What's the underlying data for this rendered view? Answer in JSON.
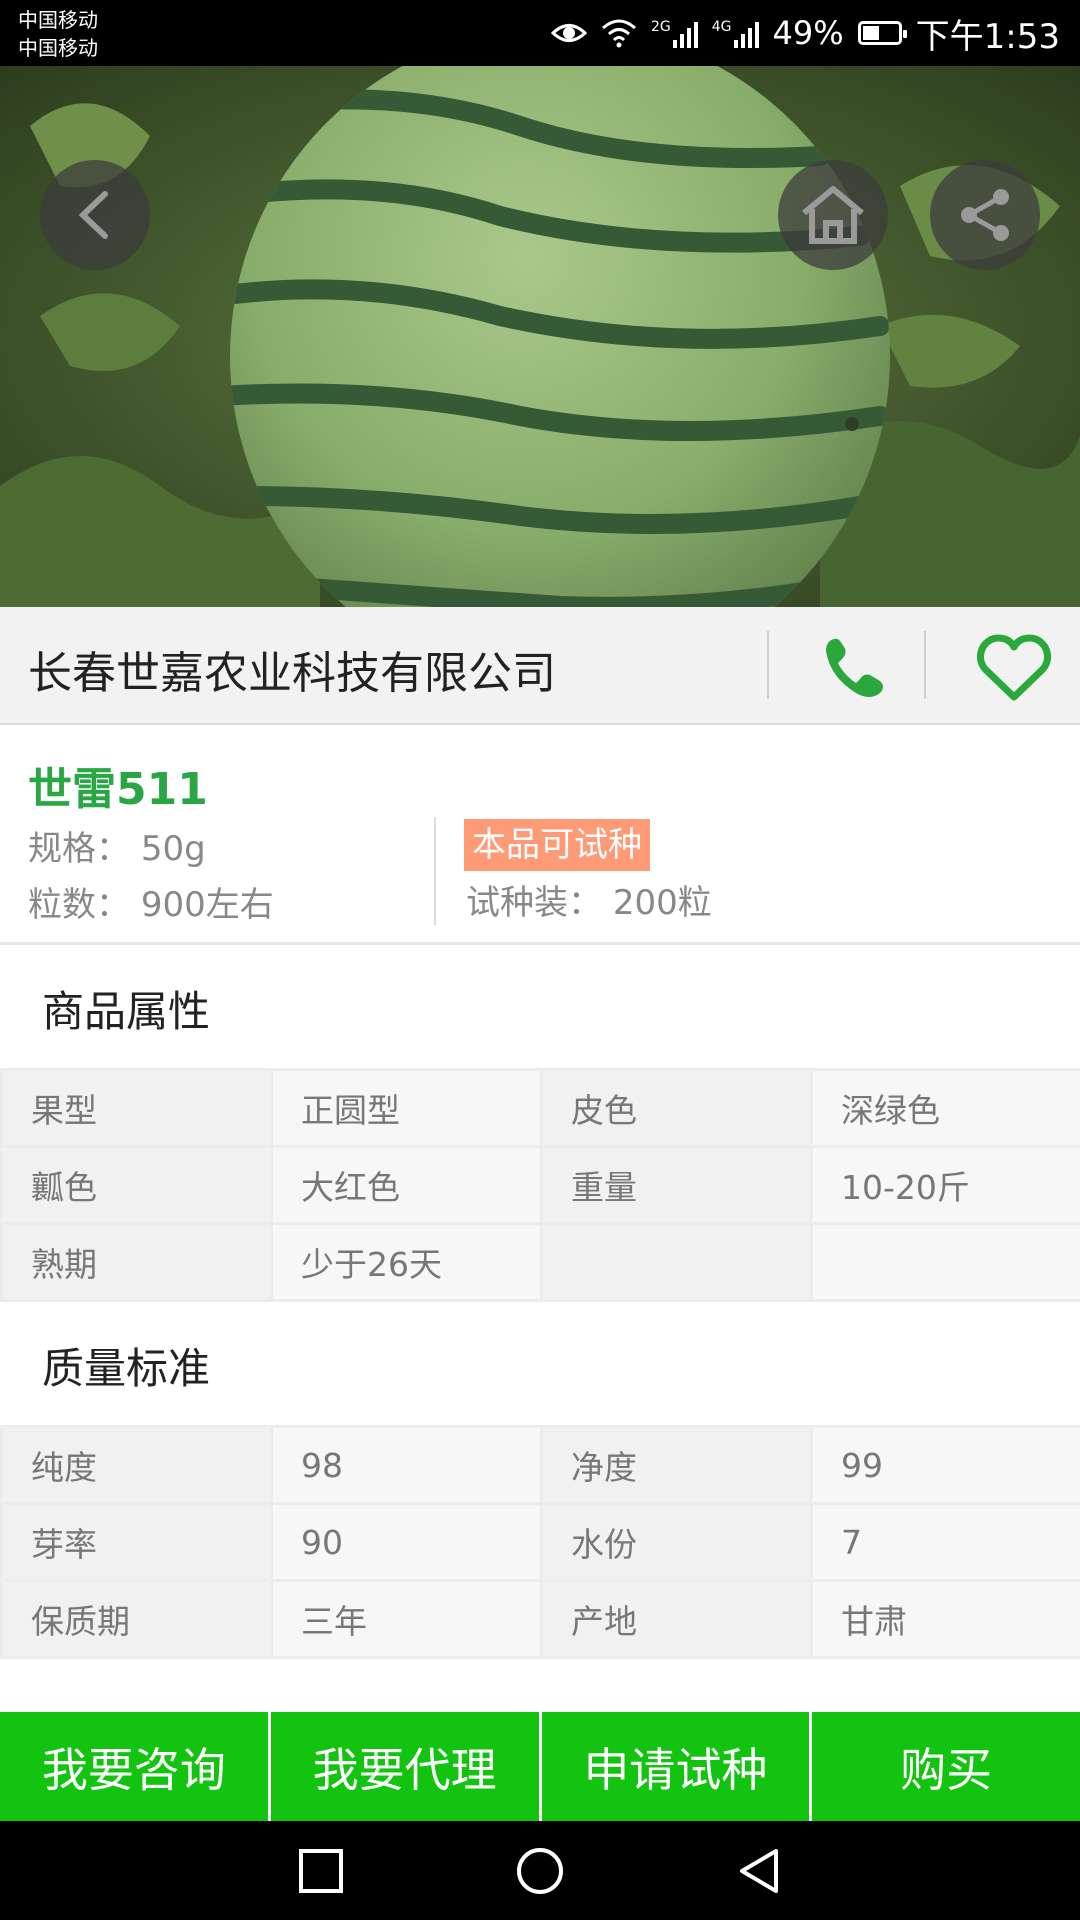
{
  "status_bar": {
    "carrier_1": "中国移动",
    "carrier_2": "中国移动",
    "network_2g": "2G",
    "network_4g": "4G",
    "battery_percent": "49%",
    "battery_level": 0.49,
    "time": "下午1:53",
    "icons": [
      "eye-icon",
      "wifi-icon",
      "signal-icon",
      "battery-icon"
    ]
  },
  "hero": {
    "image_subject": "watermelon",
    "buttons": [
      "back-icon",
      "home-icon",
      "share-icon"
    ]
  },
  "company": {
    "name": "长春世嘉农业科技有限公司",
    "icons": [
      "phone-icon",
      "heart-icon"
    ],
    "accent_color": "#2aa83c"
  },
  "product": {
    "name": "世雷511",
    "spec_label": "规格：",
    "spec_value": "50g",
    "seeds_label": "粒数：",
    "seeds_value": "900左右",
    "trial_badge": "本品可试种",
    "trial_pack_label": "试种装：",
    "trial_pack_value": "200粒",
    "name_color": "#29a745",
    "badge_color": "#ff9a76"
  },
  "attributes": {
    "title": "商品属性",
    "rows": [
      [
        "果型",
        "正圆型",
        "皮色",
        "深绿色"
      ],
      [
        "瓤色",
        "大红色",
        "重量",
        "10-20斤"
      ],
      [
        "熟期",
        "少于26天",
        "",
        ""
      ]
    ]
  },
  "quality": {
    "title": "质量标准",
    "rows": [
      [
        "纯度",
        "98",
        "净度",
        "99"
      ],
      [
        "芽率",
        "90",
        "水份",
        "7"
      ],
      [
        "保质期",
        "三年",
        "产地",
        "甘肃"
      ]
    ]
  },
  "actions": {
    "consult": "我要咨询",
    "agent": "我要代理",
    "trial": "申请试种",
    "buy": "购买",
    "button_color": "#12c40f"
  },
  "nav": {
    "icons": [
      "recent-apps-icon",
      "home-circle-icon",
      "back-triangle-icon"
    ]
  }
}
